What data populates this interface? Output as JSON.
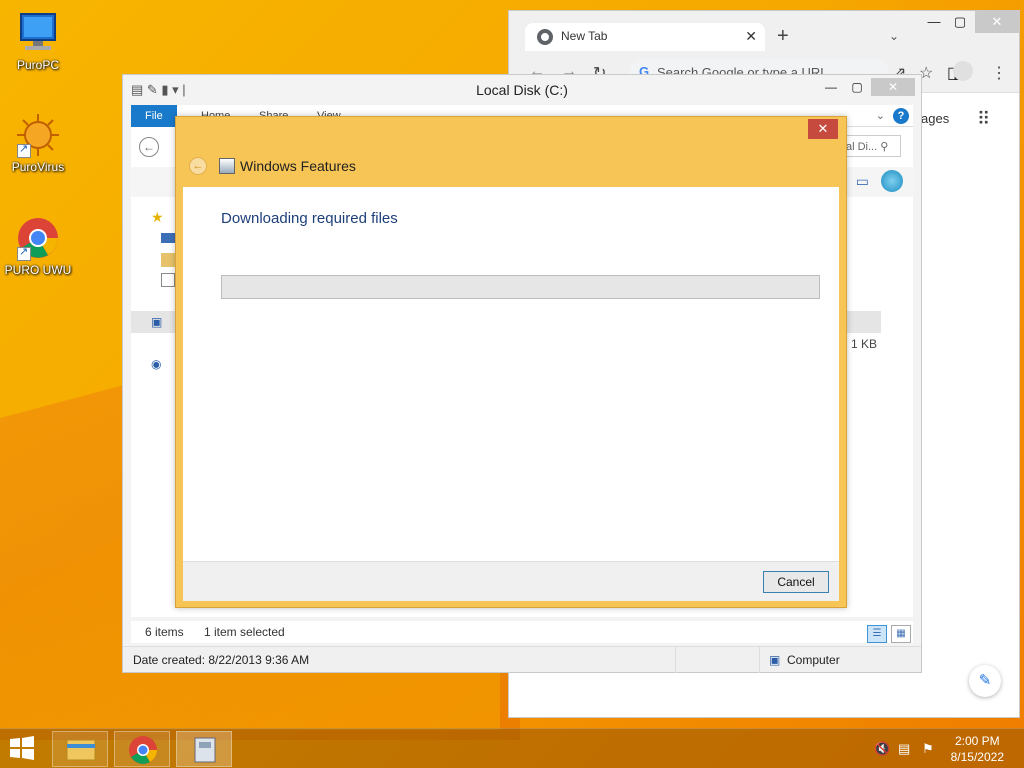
{
  "desktop": {
    "icons": [
      {
        "label": "PuroPC",
        "icon": "computer-icon"
      },
      {
        "label": "PuroVirus",
        "icon": "virus-icon"
      },
      {
        "label": "PURO UWU",
        "icon": "chrome-icon"
      }
    ]
  },
  "chrome": {
    "tab_title": "New Tab",
    "omnibox_placeholder": "Search Google or type a URL",
    "images_link": "ages"
  },
  "explorer": {
    "title": "Local Disk (C:)",
    "ribbon_tabs": [
      "File",
      "Home",
      "Share",
      "View"
    ],
    "search_placeholder": "al Di...",
    "item_size": "1 KB",
    "status_items": "6 items",
    "status_selected": "1 item selected",
    "details_date": "Date created: 8/22/2013 9:36 AM",
    "details_location": "Computer"
  },
  "dialog": {
    "title": "Windows Features",
    "heading": "Downloading required files",
    "progress": 0,
    "cancel_label": "Cancel",
    "close_label": "✕"
  },
  "taskbar": {
    "time": "2:00 PM",
    "date": "8/15/2022",
    "items": [
      "file-explorer-icon",
      "chrome-icon",
      "windows-features-icon"
    ]
  },
  "colors": {
    "accent_blue": "#1979ca",
    "dialog_frame": "#f7c556",
    "close_red": "#c74a3f"
  }
}
